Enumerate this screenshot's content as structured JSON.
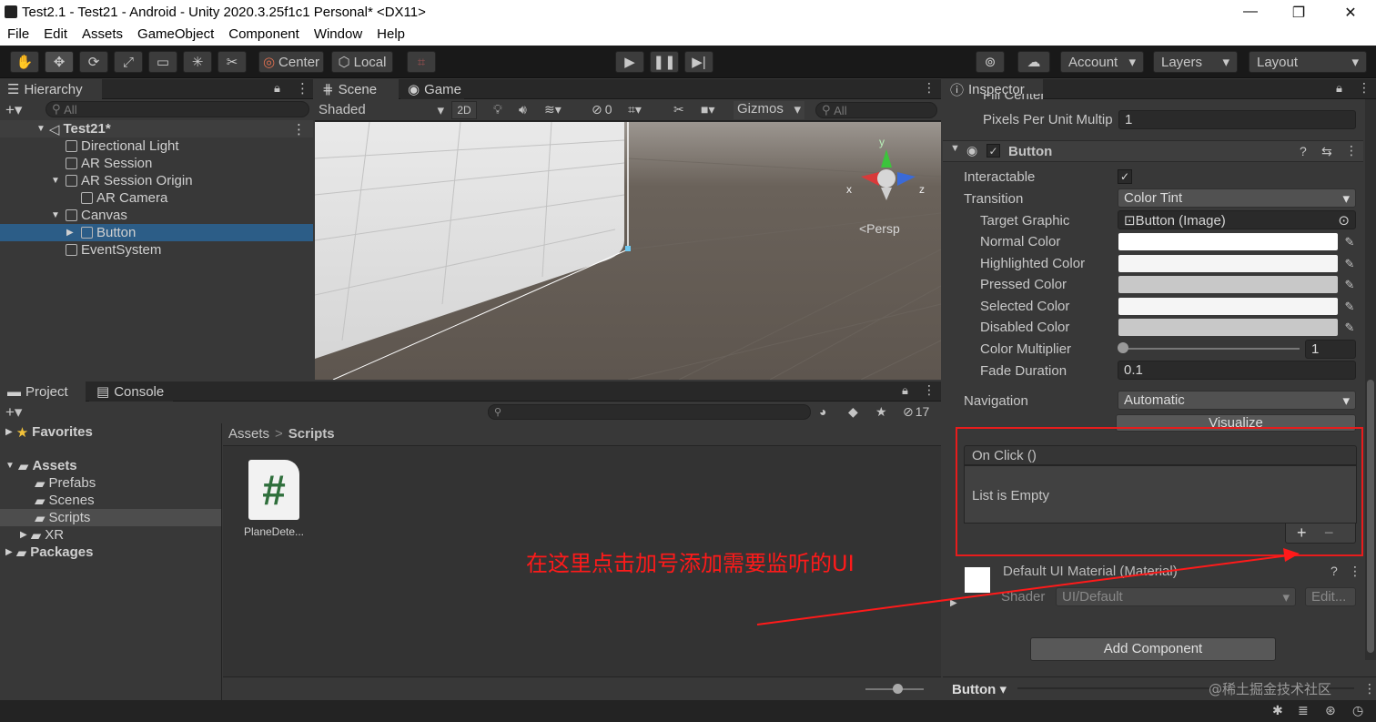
{
  "window": {
    "title": "Test2.1 - Test21 - Android - Unity 2020.3.25f1c1 Personal* <DX11>",
    "minimize": "—",
    "maximize": "❐",
    "close": "✕"
  },
  "menu": [
    "File",
    "Edit",
    "Assets",
    "GameObject",
    "Component",
    "Window",
    "Help"
  ],
  "toolbar": {
    "center_label": "Center",
    "local_label": "Local",
    "account_label": "Account",
    "layers_label": "Layers",
    "layout_label": "Layout"
  },
  "hierarchy": {
    "tab": "Hierarchy",
    "search_placeholder": "All",
    "scene": "Test21*",
    "items": [
      {
        "label": "Directional Light",
        "indent": 1,
        "expand": ""
      },
      {
        "label": "AR Session",
        "indent": 1,
        "expand": ""
      },
      {
        "label": "AR Session Origin",
        "indent": 1,
        "expand": "▼"
      },
      {
        "label": "AR Camera",
        "indent": 2,
        "expand": ""
      },
      {
        "label": "Canvas",
        "indent": 1,
        "expand": "▼"
      },
      {
        "label": "Button",
        "indent": 2,
        "expand": "▶",
        "selected": true
      },
      {
        "label": "EventSystem",
        "indent": 1,
        "expand": ""
      }
    ]
  },
  "scene": {
    "tab_scene": "Scene",
    "tab_game": "Game",
    "shading": "Shaded",
    "mode_2d": "2D",
    "hidden_count": "0",
    "gizmos": "Gizmos",
    "search_placeholder": "All",
    "persp_label": "<Persp",
    "axis_x": "x",
    "axis_y": "y",
    "axis_z": "z"
  },
  "project": {
    "tab_project": "Project",
    "tab_console": "Console",
    "hidden_count": "17",
    "favorites": "Favorites",
    "assets": "Assets",
    "folders": [
      "Prefabs",
      "Scenes",
      "Scripts",
      "XR"
    ],
    "packages": "Packages",
    "breadcrumb_root": "Assets",
    "breadcrumb_sep": ">",
    "breadcrumb_current": "Scripts",
    "file_name": "PlaneDete...",
    "file_icon": "#"
  },
  "annotation": {
    "text": "在这里点击加号添加需要监听的UI",
    "color": "#ff1a1a"
  },
  "inspector": {
    "tab": "Inspector",
    "partial_label": "Fill Center",
    "ppu_label": "Pixels Per Unit Multip",
    "ppu_value": "1",
    "component": "Button",
    "props": {
      "interactable": "Interactable",
      "transition": "Transition",
      "transition_value": "Color Tint",
      "target_graphic": "Target Graphic",
      "target_graphic_value": "Button (Image)",
      "normal": "Normal Color",
      "highlighted": "Highlighted Color",
      "pressed": "Pressed Color",
      "selected": "Selected Color",
      "disabled": "Disabled Color",
      "multiplier": "Color Multiplier",
      "multiplier_value": "1",
      "fade": "Fade Duration",
      "fade_value": "0.1",
      "navigation": "Navigation",
      "navigation_value": "Automatic",
      "visualize": "Visualize"
    },
    "onclick_header": "On Click ()",
    "onclick_empty": "List is Empty",
    "add_symbol": "+",
    "remove_symbol": "−",
    "material_name": "Default UI Material (Material)",
    "shader_label": "Shader",
    "shader_value": "UI/Default",
    "edit_label": "Edit...",
    "add_component": "Add Component",
    "footer_label": "Button ▾",
    "colors": {
      "normal": "#ffffff",
      "highlighted": "#f5f5f5",
      "pressed": "#c8c8c8",
      "selected": "#f5f5f5",
      "disabled": "#c8c8c8"
    }
  },
  "watermark": "@稀土掘金技术社区"
}
